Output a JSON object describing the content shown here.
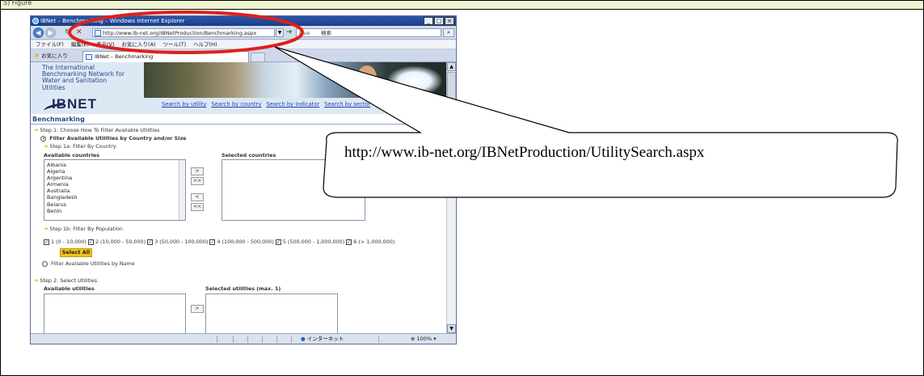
{
  "top_strip": {
    "text": "5) Figure"
  },
  "browser": {
    "title": "IBNet – Benchmarking – Windows Internet Explorer",
    "window_buttons": [
      "_",
      "□",
      "×"
    ],
    "url": "http://www.ib-net.org/IBNetProduction/Benchmarking.aspx",
    "search_placeholder": "検索",
    "search_engine": "Live",
    "menu": [
      "ファイル(F)",
      "編集(E)",
      "表示(V)",
      "お気に入り(A)",
      "ツール(T)",
      "ヘルプ(H)"
    ],
    "favorites_label": "お気に入り",
    "tab_label": "IBNet – Benchmarking",
    "status_zone": "インターネット",
    "status_zoom": "100%"
  },
  "page": {
    "header_text": "The International Benchmarking Network for Water and Sanitation Utilities",
    "brand": "IBNET",
    "nav": [
      "Search by utility",
      "Search by country",
      "Search by indicator",
      "Search by sector"
    ],
    "section_title": "Benchmarking",
    "step1": "Step 1: Choose How To Filter Available Utilities",
    "filter_country": "Filter Available Utilities by Country and/or Size",
    "step1a": "Step 1a: Filter By Country",
    "available_countries": "Available countries",
    "selected_countries": "Selected countries",
    "countries": [
      "Albania",
      "Algeria",
      "Argentina",
      "Armenia",
      "Australia",
      "Bangladesh",
      "Belarus",
      "Benin"
    ],
    "move_buttons": [
      ">",
      ">>",
      "<",
      "<<"
    ],
    "step1b": "Step 1b: Filter By Population",
    "population_options": [
      "1 (0 - 10,000)",
      "2 (10,000 - 50,000)",
      "3 (50,000 - 100,000)",
      "4 (100,000 - 500,000)",
      "5 (500,000 - 1,000,000)",
      "6 (> 1,000,000)"
    ],
    "select_all": "Select All",
    "filter_name": "Filter Available Utilities by Name",
    "step2": "Step 2: Select Utilities",
    "available_utilities": "Available utilities",
    "selected_utilities": "Selected utilities (max. 1)"
  },
  "callout": {
    "text": "http://www.ib-net.org/IBNetProduction/UtilitySearch.aspx",
    "highlight_color": "#e0201b"
  }
}
